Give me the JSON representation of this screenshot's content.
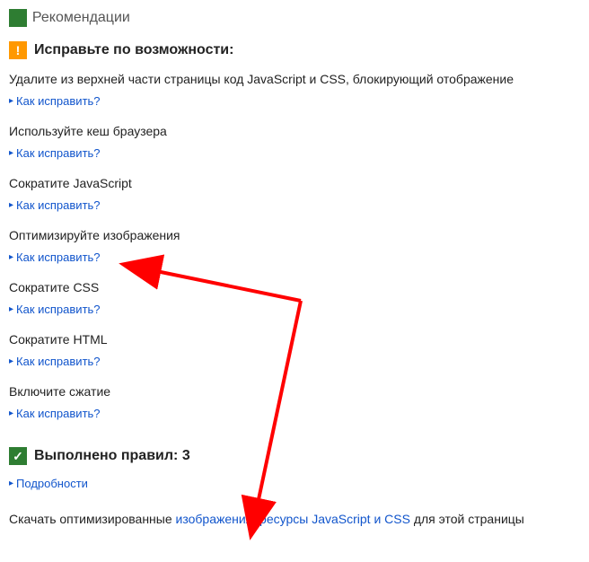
{
  "top": {
    "recs_label": "Рекомендации"
  },
  "fix_section": {
    "heading": "Исправьте по возможности:"
  },
  "items": [
    {
      "title": "Удалите из верхней части страницы код JavaScript и CSS, блокирующий отображение",
      "fix": "Как исправить?"
    },
    {
      "title": "Используйте кеш браузера",
      "fix": "Как исправить?"
    },
    {
      "title": "Сократите JavaScript",
      "fix": "Как исправить?"
    },
    {
      "title": "Оптимизируйте изображения",
      "fix": "Как исправить?"
    },
    {
      "title": "Сократите CSS",
      "fix": "Как исправить?"
    },
    {
      "title": "Сократите HTML",
      "fix": "Как исправить?"
    },
    {
      "title": "Включите сжатие",
      "fix": "Как исправить?"
    }
  ],
  "passed_section": {
    "heading": "Выполнено правил: 3",
    "details": "Подробности"
  },
  "download": {
    "prefix": "Скачать оптимизированные ",
    "link": "изображения, ресурсы JavaScript и CSS",
    "suffix": " для этой страницы"
  }
}
